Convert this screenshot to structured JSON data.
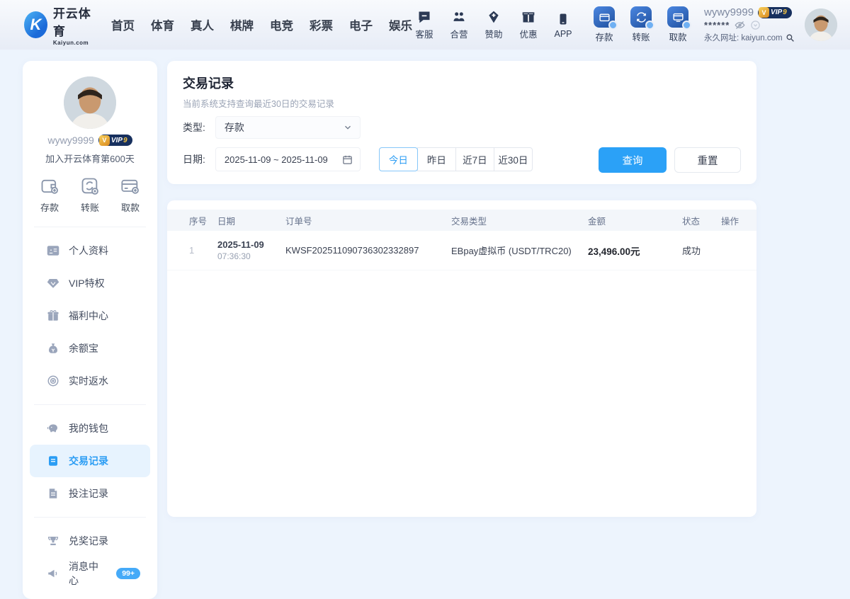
{
  "brand": {
    "name": "开云体育",
    "domain": "Kaiyun.com",
    "logo_letter": "K"
  },
  "navbar": {
    "links": [
      "首页",
      "体育",
      "真人",
      "棋牌",
      "电竞",
      "彩票",
      "电子",
      "娱乐"
    ],
    "quick_items": [
      {
        "label": "客服",
        "icon": "support-chat"
      },
      {
        "label": "合营",
        "icon": "partners"
      },
      {
        "label": "赞助",
        "icon": "sponsor"
      },
      {
        "label": "优惠",
        "icon": "promotions-gift"
      },
      {
        "label": "APP",
        "icon": "mobile-app"
      }
    ],
    "wallet_items": [
      {
        "label": "存款",
        "icon": "deposit-tile"
      },
      {
        "label": "转账",
        "icon": "transfer-tile"
      },
      {
        "label": "取款",
        "icon": "withdraw-tile"
      }
    ],
    "user": {
      "name": "wywy9999",
      "vip_label": "VIP",
      "vip_level": "9",
      "masked_balance": "******",
      "site_line": "永久网址: kaiyun.com"
    }
  },
  "sidebar": {
    "username": "wywy9999",
    "vip_label": "VIP",
    "vip_level": "9",
    "join_text": "加入开云体育第600天",
    "quick_actions": [
      {
        "label": "存款",
        "icon": "wallet"
      },
      {
        "label": "转账",
        "icon": "transfer"
      },
      {
        "label": "取款",
        "icon": "bank-card"
      }
    ],
    "menu": {
      "group1": [
        {
          "label": "个人资料",
          "icon": "id-card"
        },
        {
          "label": "VIP特权",
          "icon": "gem"
        },
        {
          "label": "福利中心",
          "icon": "gift"
        },
        {
          "label": "余额宝",
          "icon": "money-bag"
        },
        {
          "label": "实时返水",
          "icon": "target"
        }
      ],
      "group2": [
        {
          "label": "我的钱包",
          "icon": "piggy-bank"
        },
        {
          "label": "交易记录",
          "icon": "transaction-doc",
          "active": true
        },
        {
          "label": "投注记录",
          "icon": "bet-doc"
        }
      ],
      "group3": [
        {
          "label": "兑奖记录",
          "icon": "prize"
        },
        {
          "label": "消息中心",
          "icon": "megaphone",
          "badge": "99+"
        }
      ]
    }
  },
  "filters": {
    "title": "交易记录",
    "subtitle": "当前系统支持查询最近30日的交易记录",
    "type_label": "类型:",
    "type_value": "存款",
    "date_label": "日期:",
    "date_value": "2025-11-09 ~ 2025-11-09",
    "ranges": [
      "今日",
      "昨日",
      "近7日",
      "近30日"
    ],
    "active_range": "今日",
    "query_label": "查询",
    "reset_label": "重置"
  },
  "table": {
    "headers": [
      "序号",
      "日期",
      "订单号",
      "交易类型",
      "金额",
      "状态",
      "操作"
    ],
    "rows": [
      {
        "index": "1",
        "date": "2025-11-09",
        "time": "07:36:30",
        "order_no": "KWSF202511090736302332897",
        "type": "EBpay虚拟币 (USDT/TRC20)",
        "amount": "23,496.00元",
        "status": "成功",
        "action": ""
      }
    ]
  },
  "colors": {
    "primary": "#2b9df4",
    "button": "#2ba1f7",
    "vip_navy": "#17305e",
    "vip_gold": "#f5c542",
    "page_bg": "#edf4fd"
  }
}
